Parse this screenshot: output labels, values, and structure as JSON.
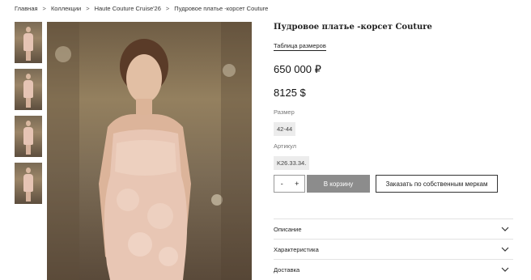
{
  "breadcrumb": {
    "items": [
      "Главная",
      "Коллекции",
      "Haute Couture Cruise'26",
      "Пудровое платье -корсет Couture"
    ],
    "separator": ">"
  },
  "product": {
    "title": "Пудровое платье -корсет Couture",
    "size_table_link": "Таблица размеров",
    "price_rub": "650 000 ₽",
    "price_usd": "8125 $",
    "size_label": "Размер",
    "size_value": "42-44",
    "article_label": "Артикул",
    "article_value": "K26.33.34."
  },
  "actions": {
    "minus": "-",
    "plus": "+",
    "cart_label": "В корзину",
    "custom_order_label": "Заказать по собственным меркам"
  },
  "accordion": [
    {
      "label": "Описание"
    },
    {
      "label": "Характеристика"
    },
    {
      "label": "Доставка"
    }
  ],
  "gallery": {
    "thumbnail_count": 4
  },
  "colors": {
    "cart_button": "#8c8c8c",
    "dress": "#e6c4b4",
    "text": "#222222"
  }
}
